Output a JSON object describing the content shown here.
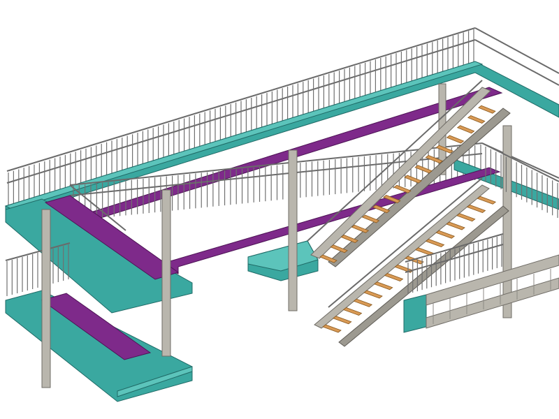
{
  "scene": {
    "colors": {
      "background": "#ffffff",
      "teal_beams": "#3aa8a0",
      "purple_beams": "#7e2a8a",
      "steel_members": "#b9b6ad",
      "stair_treads": "#d99a55",
      "railing": "#6a6a6a"
    },
    "components": [
      "upper-walkway",
      "middle-walkway",
      "lower-left-platform",
      "lower-right-platform",
      "upper-stair-flight",
      "lower-stair-flight",
      "support-columns",
      "guard-railings"
    ]
  }
}
